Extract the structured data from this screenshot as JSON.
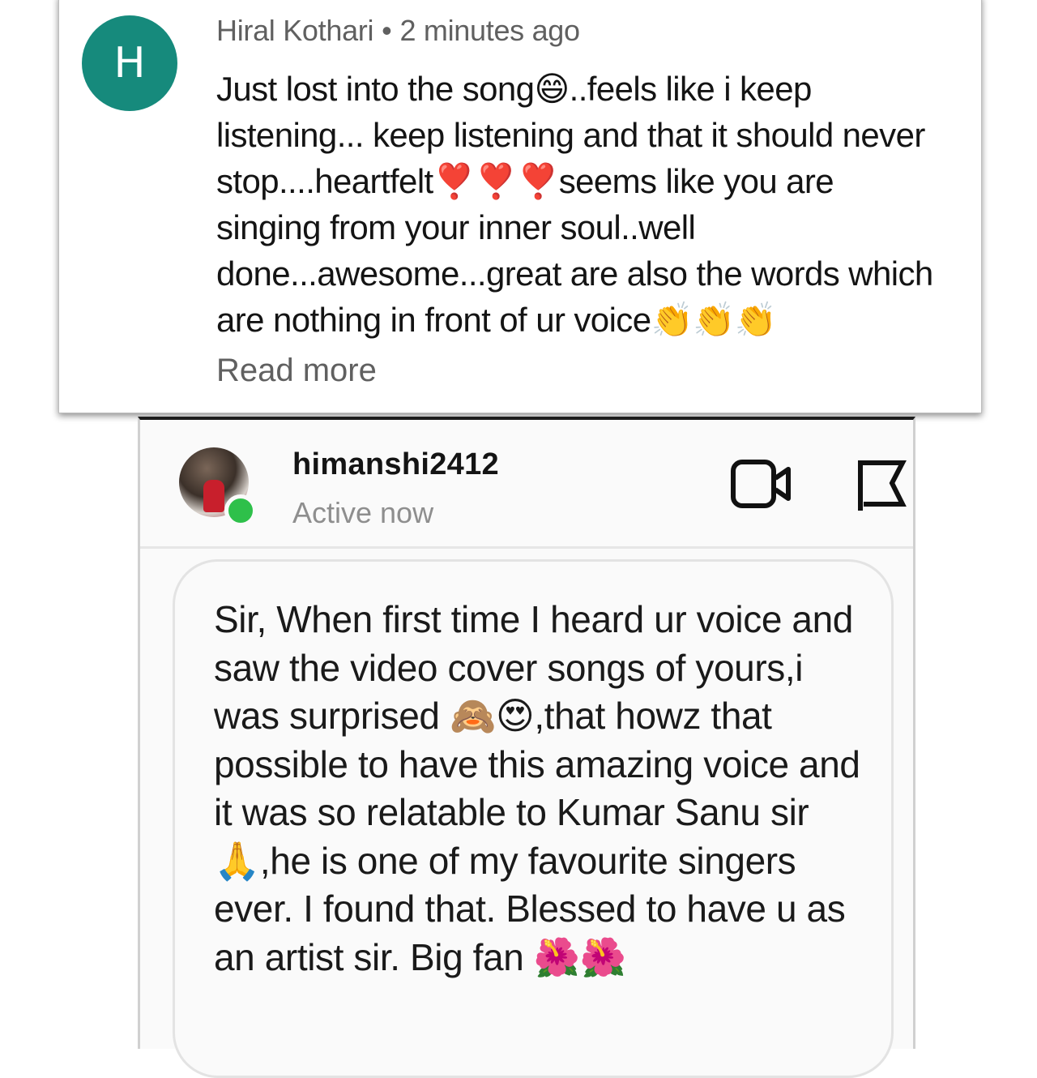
{
  "comment": {
    "avatar_letter": "H",
    "author": "Hiral Kothari",
    "separator": "•",
    "time": "2 minutes ago",
    "text": "Just lost into the song😄..feels like i keep listening... keep listening and that it should never stop....heartfelt❣️❣️❣️seems like you are singing from your inner soul..well done...awesome...great are also the words which are nothing in front of ur voice👏👏👏",
    "read_more": "Read more"
  },
  "dm": {
    "username": "himanshi2412",
    "status": "Active now",
    "icons": [
      "video-call-icon",
      "flag-icon"
    ],
    "message": "Sir, When first time I heard ur voice and saw the video cover songs of yours,i was surprised 🙈😍,that howz that possible to have this amazing voice and it was so relatable to Kumar Sanu sir 🙏,he is one of my favourite singers ever. I found that. Blessed to have u as an artist sir. Big fan 🌺🌺"
  },
  "colors": {
    "avatar_bg": "#168a7c",
    "online": "#2ec04a",
    "meta_text": "#606060",
    "status_text": "#8e8e8e"
  }
}
